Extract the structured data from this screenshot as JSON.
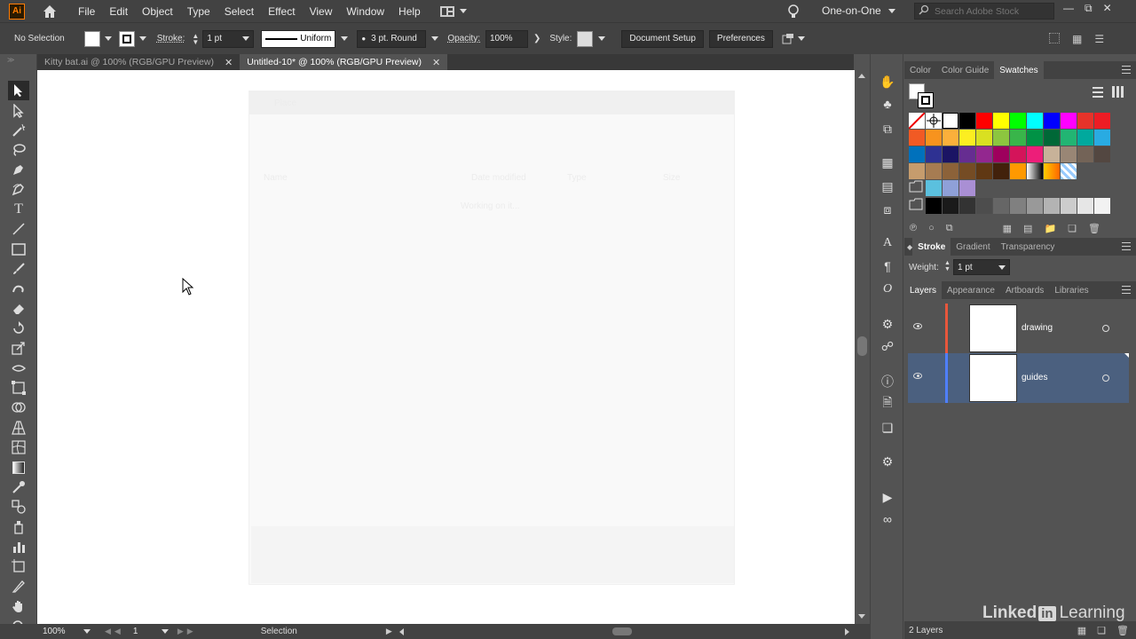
{
  "app": {
    "logo_text": "Ai"
  },
  "menu": {
    "items": [
      "File",
      "Edit",
      "Object",
      "Type",
      "Select",
      "Effect",
      "View",
      "Window",
      "Help"
    ]
  },
  "workspace": {
    "name": "One-on-One"
  },
  "search": {
    "placeholder": "Search Adobe Stock"
  },
  "control": {
    "selection": "No Selection",
    "stroke_label": "Stroke:",
    "stroke_weight": "1 pt",
    "profile": "Uniform",
    "brush": "3 pt. Round",
    "opacity_label": "Opacity:",
    "opacity_value": "100%",
    "style_label": "Style:",
    "document_setup": "Document Setup",
    "preferences": "Preferences"
  },
  "tabs": [
    {
      "label": "Kitty bat.ai @ 100% (RGB/GPU Preview)",
      "active": false
    },
    {
      "label": "Untitled-10* @ 100% (RGB/GPU Preview)",
      "active": true
    }
  ],
  "ghost_dialog": {
    "title": "Place",
    "col_name": "Name",
    "col_date": "Date modified",
    "col_type": "Type",
    "col_size": "Size",
    "empty_msg": "Working on it..."
  },
  "status": {
    "zoom": "100%",
    "artboard": "1",
    "tool": "Selection"
  },
  "swatches_panel": {
    "tabs": [
      "Color",
      "Color Guide",
      "Swatches"
    ],
    "active": "Swatches",
    "rows": [
      [
        "#ffffff",
        "#ffffff",
        "#ffffff",
        "#000000",
        "#ff0000",
        "#ffff00",
        "#00ff00",
        "#00ffff",
        "#0000ff",
        "#ff00ff",
        "#e6332a",
        "#ed1c24"
      ],
      [
        "#f15a24",
        "#f7931e",
        "#fbb03b",
        "#fcee21",
        "#d9e021",
        "#8cc63f",
        "#39b54a",
        "#009245",
        "#006837",
        "#22b573",
        "#00a99d",
        "#29abe2"
      ],
      [
        "#0071bc",
        "#2e3192",
        "#1b1464",
        "#662d91",
        "#93278f",
        "#9e005d",
        "#d4145a",
        "#ed1e79",
        "#c7b299",
        "#998675",
        "#736357",
        "#534741"
      ],
      [
        "#c69c6d",
        "#a67c52",
        "#8c6239",
        "#754c24",
        "#603813",
        "#42210b",
        "#ff9900",
        "#cccccc",
        "#99ccff",
        "#3366cc"
      ],
      [
        "#5bc0de",
        "#8fa0d8",
        "#a98fd4"
      ],
      [
        "#000000",
        "#1a1a1a",
        "#333333",
        "#4d4d4d",
        "#666666",
        "#808080",
        "#999999",
        "#b3b3b3",
        "#cccccc",
        "#e6e6e6",
        "#f2f2f2"
      ]
    ]
  },
  "stroke_panel": {
    "tabs": [
      "Stroke",
      "Gradient",
      "Transparency"
    ],
    "active": "Stroke",
    "weight_label": "Weight:",
    "weight_value": "1 pt"
  },
  "layers_panel": {
    "tabs": [
      "Layers",
      "Appearance",
      "Artboards",
      "Libraries"
    ],
    "active": "Layers",
    "layers": [
      {
        "name": "drawing",
        "color": "#e8573c",
        "selected": false
      },
      {
        "name": "guides",
        "color": "#4f7fff",
        "selected": true
      }
    ],
    "count": "2 Layers"
  },
  "watermark": {
    "text": "Linked",
    "badge": "in",
    "suffix": "Learning"
  }
}
